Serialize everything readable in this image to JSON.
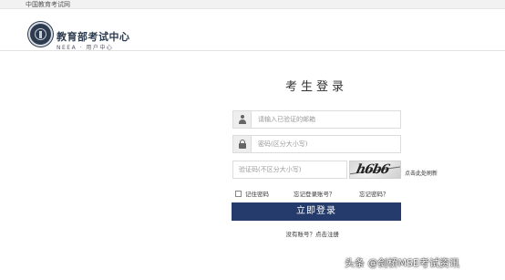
{
  "site": {
    "topbar_text": "中国教育考试网"
  },
  "header": {
    "logo_icon": "neea-seal-logo",
    "org_name": "教育部考试中心",
    "org_subtitle": "NEEA · 用户中心"
  },
  "login": {
    "title": "考生登录",
    "username": {
      "placeholder": "请输入已验证的邮箱",
      "value": "",
      "icon": "user-icon"
    },
    "password": {
      "placeholder": "密码(区分大小写)",
      "value": "",
      "icon": "lock-icon"
    },
    "captcha": {
      "placeholder": "验证码(不区分大小写)",
      "value": "",
      "image_text": "h6b6",
      "refresh_label": "点击此处刷新"
    },
    "remember_label": "记住密码",
    "remember_checked": false,
    "forgot_account_label": "忘记登录账号？",
    "forgot_password_label": "忘记密码？",
    "submit_label": "立即登录",
    "register_label": "没有账号？点击注册"
  },
  "watermark": {
    "text": "头条 @剑桥MSE考试资讯"
  },
  "colors": {
    "primary_button": "#243b6b",
    "logo": "#2c3b4f"
  }
}
